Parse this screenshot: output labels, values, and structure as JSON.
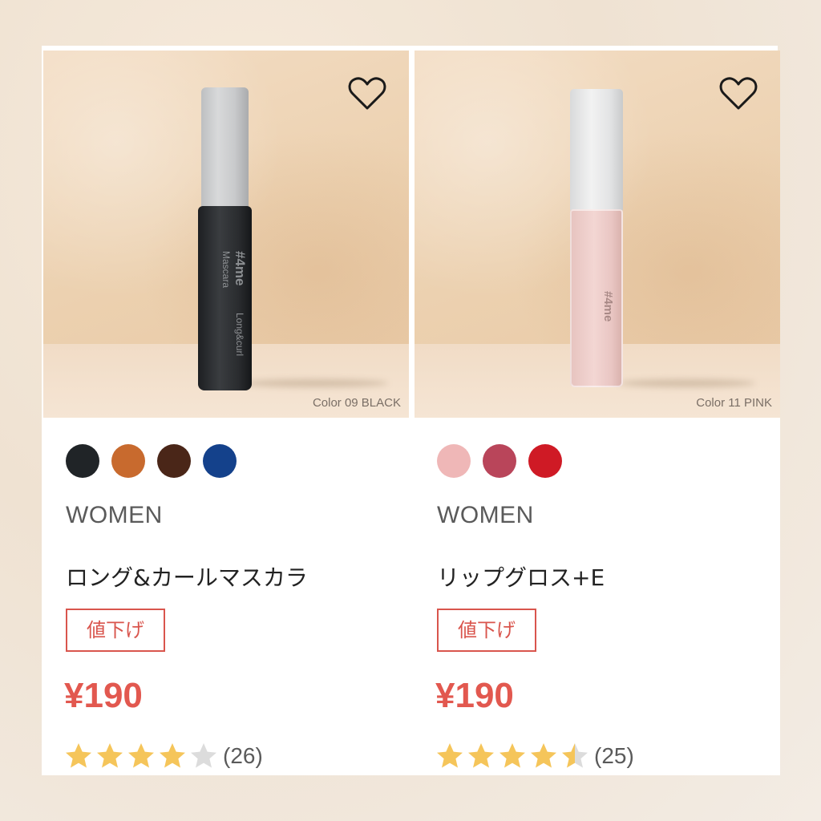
{
  "products": [
    {
      "image_caption": "Color 09 BLACK",
      "product_print": [
        "#4me",
        "Long&curl",
        "Mascara"
      ],
      "swatches": [
        "#202427",
        "#c86a2e",
        "#4a2618",
        "#14418b"
      ],
      "gender": "WOMEN",
      "name": "ロング&カールマスカラ",
      "badge": "値下げ",
      "price": "¥190",
      "rating_value": 4,
      "rating_count": "(26)"
    },
    {
      "image_caption": "Color 11 PINK",
      "product_print": [
        "#4me"
      ],
      "swatches": [
        "#efb7b7",
        "#b9455a",
        "#cf1a25"
      ],
      "gender": "WOMEN",
      "name": "リップグロス+E",
      "badge": "値下げ",
      "price": "¥190",
      "rating_value": 4.5,
      "rating_count": "(25)"
    }
  ],
  "icons": {
    "favorite": "heart-outline-icon",
    "star": "star-icon"
  },
  "colors": {
    "price": "#e2584f",
    "badge": "#d9554d",
    "star_filled": "#f5c55a",
    "star_empty": "#dcdcdc"
  }
}
